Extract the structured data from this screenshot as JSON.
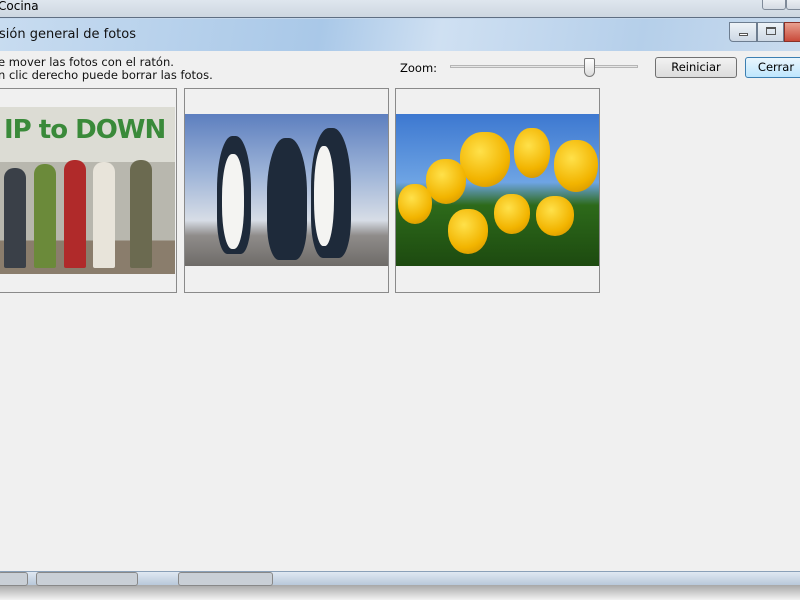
{
  "outer_window": {
    "title": "Cocina"
  },
  "dialog": {
    "title": "sión general de fotos",
    "hints": [
      "e mover las fotos con el ratón.",
      "n clic derecho puede borrar las fotos."
    ],
    "zoom": {
      "label": "Zoom:",
      "value_percent": 74
    },
    "buttons": {
      "reset": "Reiniciar",
      "close": "Cerrar"
    },
    "photos": [
      {
        "name": "group-photo",
        "logo_text": "IP to DOWN"
      },
      {
        "name": "penguins-photo"
      },
      {
        "name": "tulips-photo"
      }
    ]
  },
  "colors": {
    "title_bar": "#b5cfea",
    "content_bg": "#f0f0f0",
    "close_button": "#c94a3a",
    "focus_button": "#3c7fb1"
  }
}
